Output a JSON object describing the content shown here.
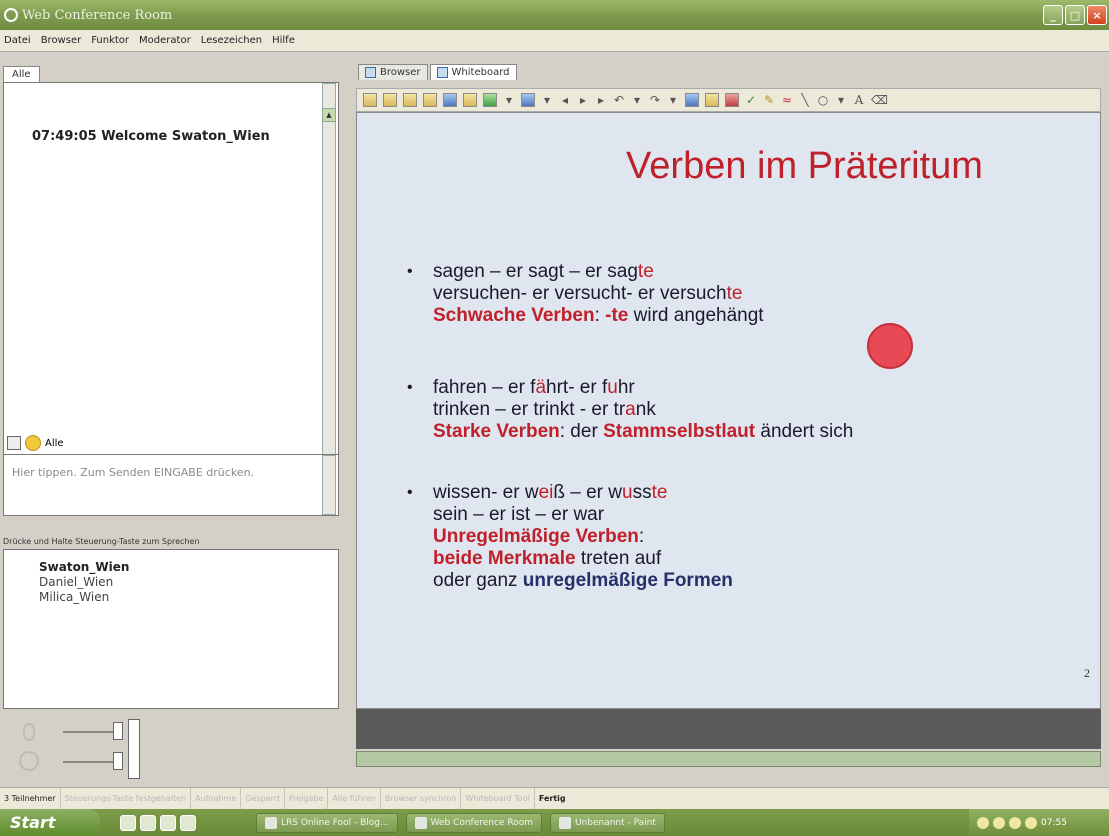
{
  "window": {
    "title": "Web Conference Room"
  },
  "menu": [
    "Datei",
    "Browser",
    "Funktor",
    "Moderator",
    "Lesezeichen",
    "Hilfe"
  ],
  "chat": {
    "tab": "Alle",
    "messages": [
      {
        "text": "07:49:05 Welcome Swaton_Wien"
      }
    ],
    "recipient": "Alle",
    "input_placeholder": "Hier tippen. Zum Senden EINGABE drücken."
  },
  "participants": {
    "ptt_label": "Drücke und Halte Steuerung-Taste zum Sprechen",
    "users": [
      {
        "name": "Swaton_Wien",
        "bold": true
      },
      {
        "name": "Daniel_Wien",
        "bold": false
      },
      {
        "name": "Milica_Wien",
        "bold": false
      }
    ]
  },
  "tabs": {
    "browser": "Browser",
    "whiteboard": "Whiteboard"
  },
  "slide": {
    "title": "Verben im Präteritum",
    "number": "2"
  },
  "status": {
    "count": "3 Teilnehmer",
    "seg2": "Steuerungs-Taste festgehalten",
    "seg3": "Aufnahme",
    "seg4": "Gesperrt",
    "seg5": "Freigabe",
    "seg6": "Alle führen",
    "seg7": "Browser synchron",
    "seg8": "Whiteboard Tool",
    "done": "Fertig"
  },
  "taskbar": {
    "start": "Start",
    "items": [
      "LRS Online Fool - Blog...",
      "Web Conference Room",
      "Unbenannt - Paint"
    ],
    "clock": "07:55"
  }
}
